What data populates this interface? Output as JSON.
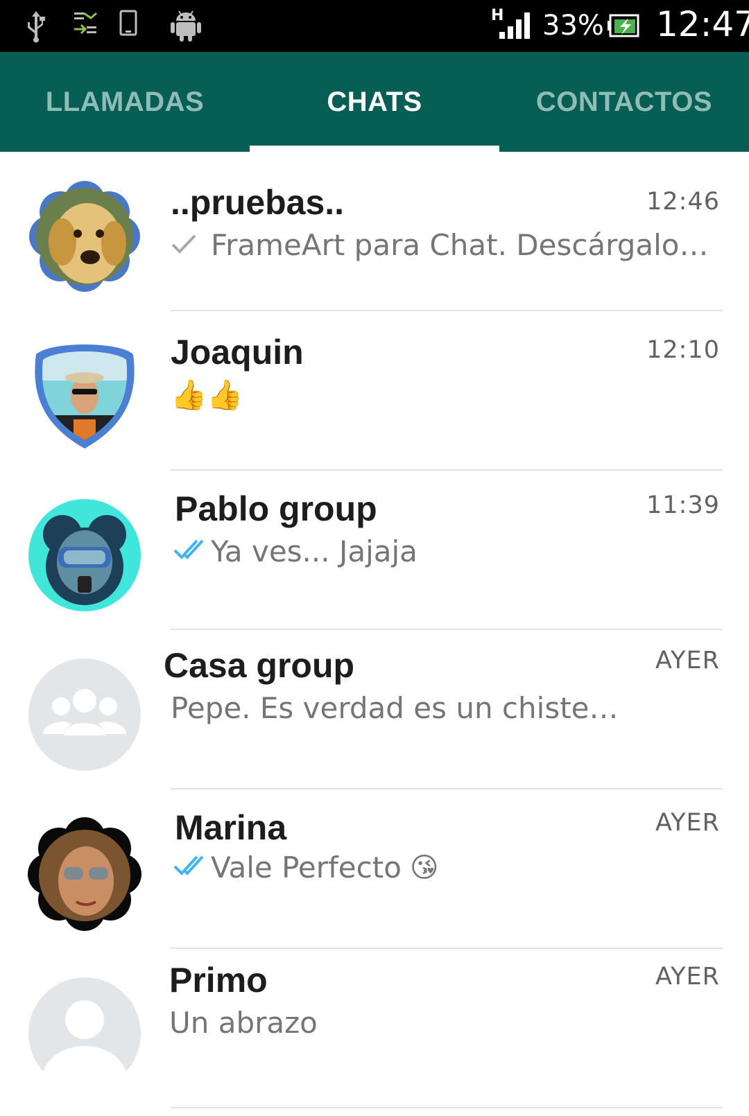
{
  "status_bar": {
    "network_type": "H",
    "battery_percent": "33%",
    "time": "12:47",
    "icons": [
      "usb-icon",
      "data-transfer-icon",
      "phone-outline-icon",
      "android-icon",
      "signal-icon",
      "battery-charging-icon"
    ]
  },
  "tabs": [
    {
      "label": "LLAMADAS",
      "active": false
    },
    {
      "label": "CHATS",
      "active": true
    },
    {
      "label": "CONTACTOS",
      "active": false
    }
  ],
  "colors": {
    "brand": "#075e54",
    "tab_inactive": "#8fbcb5",
    "read_ticks": "#3fb4f0",
    "sent_tick": "#a8a8a8",
    "placeholder_avatar": "#e3e6e8"
  },
  "chats": [
    {
      "name": "..pruebas..",
      "time": "12:46",
      "preview": "FrameArt para Chat. Descárgalo…",
      "status_icon": "sent-check-icon",
      "avatar": "dog-photo-flower-frame"
    },
    {
      "name": "Joaquin",
      "time": "12:10",
      "preview": "👍👍",
      "status_icon": "",
      "avatar": "man-photo-shield-frame"
    },
    {
      "name": "Pablo group",
      "time": "11:39",
      "preview": "Ya ves... Jajaja",
      "status_icon": "read-double-check-icon",
      "avatar": "diver-photo-mouse-frame"
    },
    {
      "name": "Casa group",
      "time": "AYER",
      "preview": "Pepe. Es verdad es un chiste…",
      "status_icon": "",
      "avatar": "group-placeholder-icon"
    },
    {
      "name": "Marina",
      "time": "AYER",
      "preview": "Vale Perfecto",
      "preview_emoji": "😘",
      "status_icon": "read-double-check-icon",
      "avatar": "woman-photo-flower-frame"
    },
    {
      "name": "Primo",
      "time": "AYER",
      "preview": "Un abrazo",
      "status_icon": "",
      "avatar": "person-placeholder-icon"
    }
  ]
}
